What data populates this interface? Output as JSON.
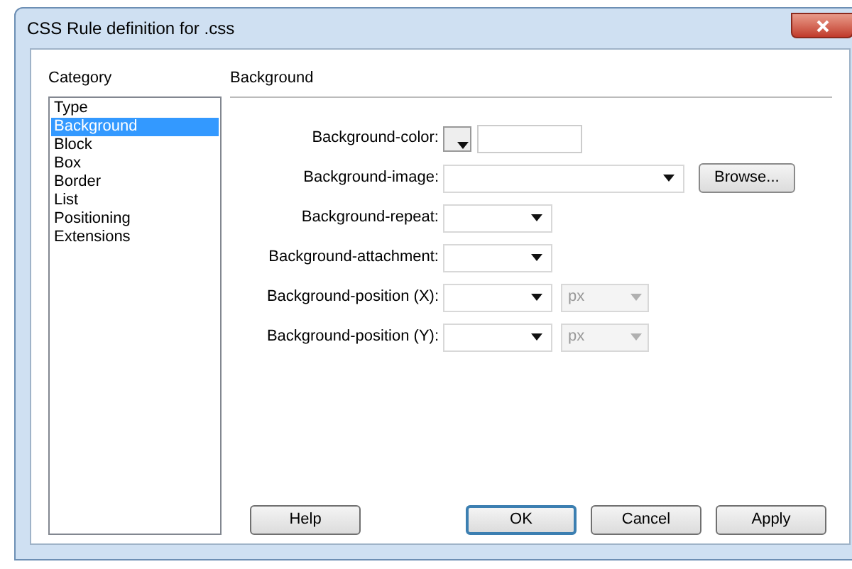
{
  "window": {
    "title": "CSS Rule definition for .css"
  },
  "category": {
    "label": "Category",
    "items": [
      {
        "label": "Type",
        "selected": false
      },
      {
        "label": "Background",
        "selected": true
      },
      {
        "label": "Block",
        "selected": false
      },
      {
        "label": "Box",
        "selected": false
      },
      {
        "label": "Border",
        "selected": false
      },
      {
        "label": "List",
        "selected": false
      },
      {
        "label": "Positioning",
        "selected": false
      },
      {
        "label": "Extensions",
        "selected": false
      }
    ]
  },
  "panel": {
    "heading": "Background",
    "fields": [
      {
        "kind": "color",
        "label": "Background-color:"
      },
      {
        "kind": "browse",
        "label": "Background-image:",
        "button": "Browse..."
      },
      {
        "kind": "select",
        "label": "Background-repeat:"
      },
      {
        "kind": "select",
        "label": "Background-attachment:"
      },
      {
        "kind": "unit",
        "label": "Background-position (X):",
        "unit": "px",
        "unit_disabled": true
      },
      {
        "kind": "unit",
        "label": "Background-position (Y):",
        "unit": "px",
        "unit_disabled": true
      }
    ]
  },
  "buttons": [
    {
      "label": "Help",
      "default": false
    },
    {
      "label": "OK",
      "default": true
    },
    {
      "label": "Cancel",
      "default": false
    },
    {
      "label": "Apply",
      "default": false
    }
  ]
}
